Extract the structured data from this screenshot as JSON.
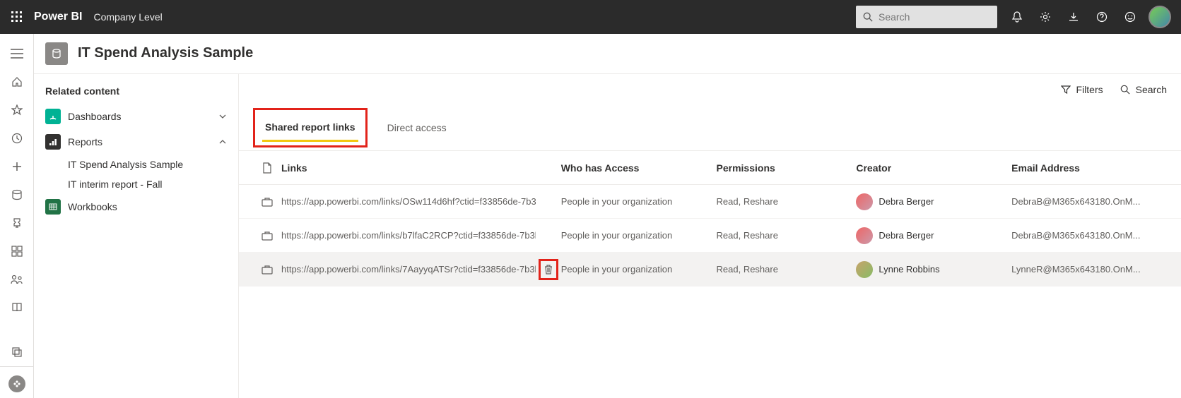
{
  "topbar": {
    "brand": "Power BI",
    "context": "Company Level",
    "search_placeholder": "Search"
  },
  "page": {
    "title": "IT Spend Analysis Sample"
  },
  "related": {
    "heading": "Related content",
    "dashboards_label": "Dashboards",
    "reports_label": "Reports",
    "report_items": [
      "IT Spend Analysis Sample",
      "IT interim report - Fall"
    ],
    "workbooks_label": "Workbooks"
  },
  "toolbar": {
    "filters_label": "Filters",
    "search_label": "Search"
  },
  "tabs": {
    "shared": "Shared report links",
    "direct": "Direct access"
  },
  "columns": {
    "links": "Links",
    "access": "Who has Access",
    "perm": "Permissions",
    "creator": "Creator",
    "email": "Email Address"
  },
  "rows": [
    {
      "link": "https://app.powerbi.com/links/OSw114d6hf?ctid=f33856de-7b3...",
      "access": "People in your organization",
      "perm": "Read, Reshare",
      "creator": "Debra Berger",
      "email": "DebraB@M365x643180.OnM..."
    },
    {
      "link": "https://app.powerbi.com/links/b7lfaC2RCP?ctid=f33856de-7b3b...",
      "access": "People in your organization",
      "perm": "Read, Reshare",
      "creator": "Debra Berger",
      "email": "DebraB@M365x643180.OnM..."
    },
    {
      "link": "https://app.powerbi.com/links/7AayyqATSr?ctid=f33856de-7b3b.",
      "access": "People in your organization",
      "perm": "Read, Reshare",
      "creator": "Lynne Robbins",
      "email": "LynneR@M365x643180.OnM..."
    }
  ]
}
